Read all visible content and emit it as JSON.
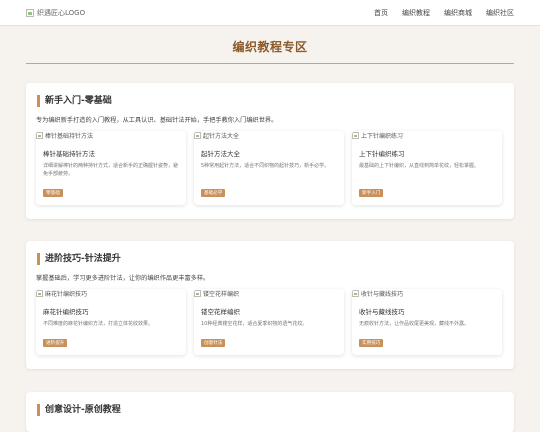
{
  "nav": {
    "logo_alt": "织遇匠心LOGO",
    "items": [
      "首页",
      "编织教程",
      "编织商城",
      "编织社区"
    ]
  },
  "hero": {
    "title": "编织教程专区"
  },
  "sections": [
    {
      "title": "新手入门-零基础",
      "desc": "专为编织新手打造的入门教程，从工具认识、基础针法开始，手把手教你入门编织世界。",
      "cards": [
        {
          "img_alt": "棒针基础持针方法",
          "title": "棒针基础持针方法",
          "desc": "详细讲解棒针的两种持针方式，适合新手的正确握针姿势，避免手部疲劳。",
          "tag": "零基础"
        },
        {
          "img_alt": "起针方法大全",
          "title": "起针方法大全",
          "desc": "5种常用起针方法，适合不同织物的起针技巧，新手必学。",
          "tag": "基础必学"
        },
        {
          "img_alt": "上下针编织练习",
          "title": "上下针编织练习",
          "desc": "最基础的上下针编织，从直线到简单花纹，轻松掌握。",
          "tag": "新手入门"
        }
      ]
    },
    {
      "title": "进阶技巧-针法提升",
      "desc": "掌握基础后，学习更多进阶针法，让你的编织作品更丰富多样。",
      "cards": [
        {
          "img_alt": "麻花针编织技巧",
          "title": "麻花针编织技巧",
          "desc": "不同难度的麻花针编织方法，打造立体花纹效果。",
          "tag": "进阶提升"
        },
        {
          "img_alt": "镂空花样编织",
          "title": "镂空花样编织",
          "desc": "10种经典镂空花样，适合夏季织物的透气花纹。",
          "tag": "创意针法"
        },
        {
          "img_alt": "收针与藏线技巧",
          "title": "收针与藏线技巧",
          "desc": "无痕收针方法，让作品收尾更美观，藏线不外露。",
          "tag": "实用技巧"
        }
      ]
    }
  ],
  "partial_section": {
    "title": "创意设计-原创教程"
  }
}
